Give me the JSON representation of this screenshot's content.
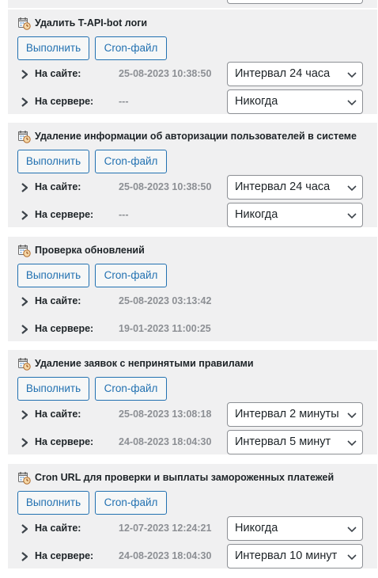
{
  "tasks": [
    {
      "title": "Удалить T-API-bot логи",
      "run_label": "Выполнить",
      "cron_label": "Cron-файл",
      "site_label": "На сайте:",
      "site_time": "25-08-2023 10:38:50",
      "site_interval": "Интервал 24 часа",
      "server_label": "На сервере:",
      "server_time": "---",
      "server_interval": "Никогда"
    },
    {
      "title": "Удаление информации об авторизации пользователей в системе",
      "run_label": "Выполнить",
      "cron_label": "Cron-файл",
      "site_label": "На сайте:",
      "site_time": "25-08-2023 10:38:50",
      "site_interval": "Интервал 24 часа",
      "server_label": "На сервере:",
      "server_time": "---",
      "server_interval": "Никогда"
    },
    {
      "title": "Проверка обновлений",
      "run_label": "Выполнить",
      "cron_label": "Cron-файл",
      "site_label": "На сайте:",
      "site_time": "25-08-2023 03:13:42",
      "site_interval": null,
      "server_label": "На сервере:",
      "server_time": "19-01-2023 11:00:25",
      "server_interval": null
    },
    {
      "title": "Удаление заявок с непринятыми правилами",
      "run_label": "Выполнить",
      "cron_label": "Cron-файл",
      "site_label": "На сайте:",
      "site_time": "25-08-2023 13:08:18",
      "site_interval": "Интервал 2 минуты",
      "server_label": "На сервере:",
      "server_time": "24-08-2023 18:04:30",
      "server_interval": "Интервал 5 минут"
    },
    {
      "title": "Cron URL для проверки и выплаты замороженных платежей",
      "run_label": "Выполнить",
      "cron_label": "Cron-файл",
      "site_label": "На сайте:",
      "site_time": "12-07-2023 12:24:21",
      "site_interval": "Никогда",
      "server_label": "На сервере:",
      "server_time": "24-08-2023 18:04:30",
      "server_interval": "Интервал 10 минут"
    }
  ],
  "icons": {
    "task_icon": "calendar-clock-icon",
    "row_toggle": "chevron-right-icon",
    "select_caret": "chevron-down-icon"
  },
  "colors": {
    "panel_bg": "#f0f0f1",
    "button_blue": "#2271b1",
    "time_gray": "#8c8f94",
    "text_dark": "#1d2327"
  }
}
